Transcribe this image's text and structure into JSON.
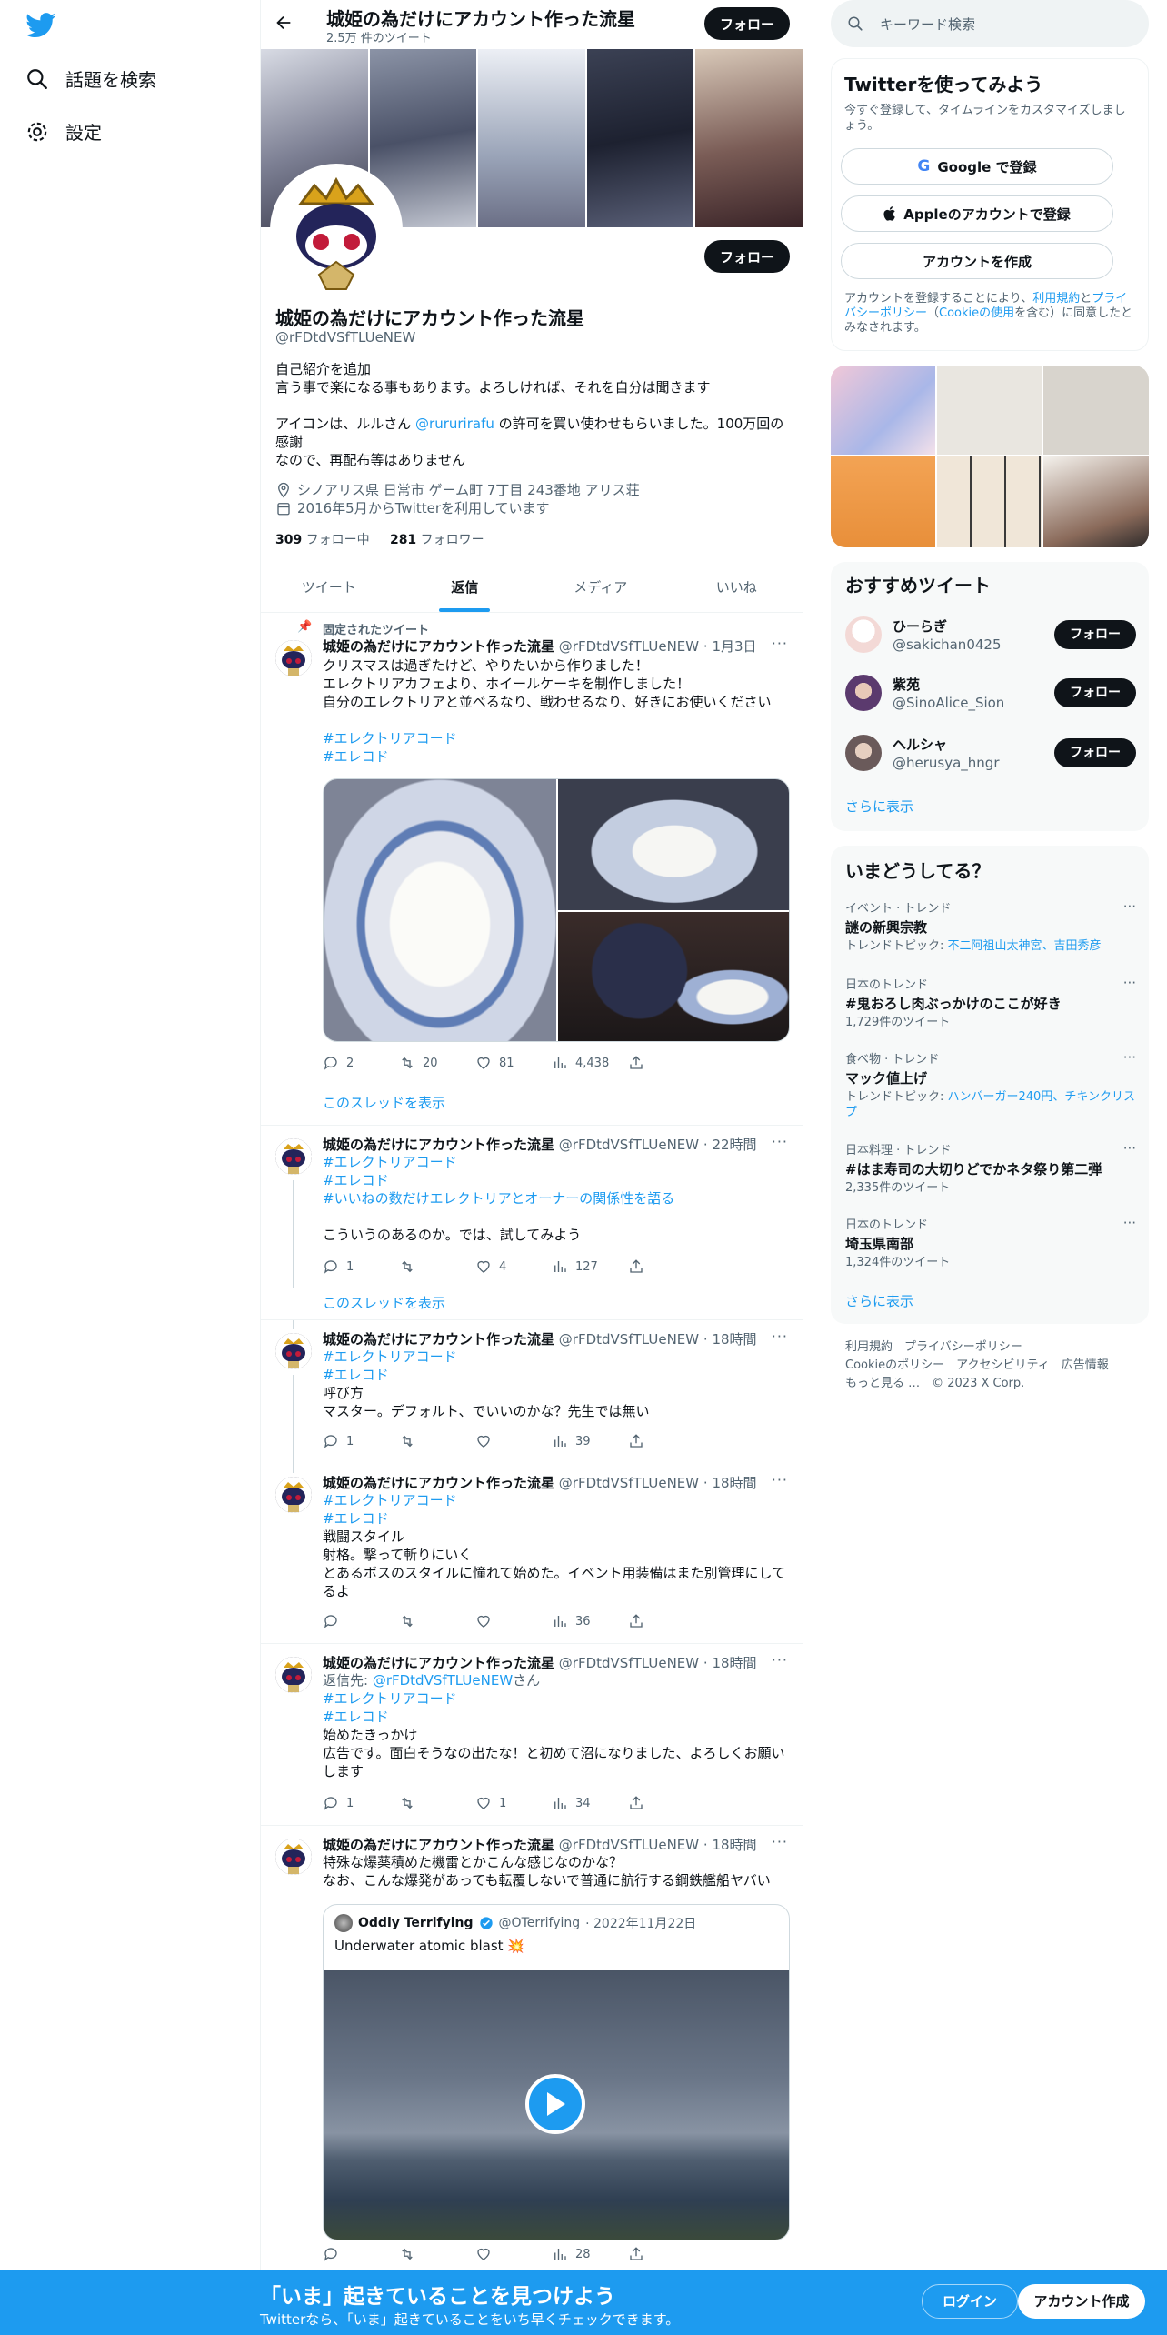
{
  "nav": {
    "explore": "話題を検索",
    "settings": "設定"
  },
  "header": {
    "title": "城姫の為だけにアカウント作った流星",
    "tweet_count": "2.5万 件のツイート",
    "follow": "フォロー"
  },
  "profile": {
    "name": "城姫の為だけにアカウント作った流星",
    "handle": "@rFDtdVSfTLUeNEW",
    "follow": "フォロー",
    "bio_line1": "自己紹介を追加",
    "bio_line2": "言う事で楽になる事もあります。よろしければ、それを自分は聞きます",
    "bio_line3a": "アイコンは、ルルさん ",
    "bio_mention": "@rururirafu",
    "bio_line3b": " の許可を買い使わせもらいました。100万回の感謝",
    "bio_line4": "なので、再配布等はありません",
    "location": "シノアリス県 日常市 ゲーム町 7丁目 243番地 アリス荘",
    "joined": "2016年5月からTwitterを利用しています",
    "following_count": "309",
    "following_label": "フォロー中",
    "followers_count": "281",
    "followers_label": "フォロワー"
  },
  "tabs": [
    "ツイート",
    "返信",
    "メディア",
    "いいね"
  ],
  "tweets": [
    {
      "pinned": "固定されたツイート",
      "name": "城姫の為だけにアカウント作った流星",
      "handle": "@rFDtdVSfTLUeNEW",
      "time": "· 1月3日",
      "text1": "クリスマスは過ぎたけど、やりたいから作りました！",
      "text2": "エレクトリアカフェより、ホイールケーキを制作しました！",
      "text3": "自分のエレクトリアと並べるなり、戦わせるなり、好きにお使いください",
      "tag1": "#エレクトリアコード",
      "tag2": "#エレコド",
      "replies": "2",
      "retweets": "20",
      "likes": "81",
      "views": "4,438",
      "thread": "このスレッドを表示"
    },
    {
      "name": "城姫の為だけにアカウント作った流星",
      "handle": "@rFDtdVSfTLUeNEW",
      "time": "· 22時間",
      "tag1": "#エレクトリアコード",
      "tag2": "#エレコド",
      "tag3": "#いいねの数だけエレクトリアとオーナーの関係性を語る",
      "text1": "こういうのあるのか。では、試してみよう",
      "replies": "1",
      "retweets": "",
      "likes": "4",
      "views": "127",
      "thread": "このスレッドを表示"
    },
    {
      "name": "城姫の為だけにアカウント作った流星",
      "handle": "@rFDtdVSfTLUeNEW",
      "time": "· 18時間",
      "tag1": "#エレクトリアコード",
      "tag2": "#エレコド",
      "text1": "呼び方",
      "text2": "マスター。デフォルト、でいいのかな？先生では無い",
      "replies": "1",
      "retweets": "",
      "likes": "",
      "views": "39"
    },
    {
      "name": "城姫の為だけにアカウント作った流星",
      "handle": "@rFDtdVSfTLUeNEW",
      "time": "· 18時間",
      "tag1": "#エレクトリアコード",
      "tag2": "#エレコド",
      "text1": "戦闘スタイル",
      "text2": "射格。撃って斬りにいく",
      "text3": "とあるボスのスタイルに憧れて始めた。イベント用装備はまた別管理にしてるよ",
      "replies": "",
      "retweets": "",
      "likes": "",
      "views": "36"
    },
    {
      "name": "城姫の為だけにアカウント作った流星",
      "handle": "@rFDtdVSfTLUeNEW",
      "time": "· 18時間",
      "reply_to_label": "返信先: ",
      "reply_to": "@rFDtdVSfTLUeNEW",
      "reply_to_suffix": "さん",
      "tag1": "#エレクトリアコード",
      "tag2": "#エレコド",
      "text1": "始めたきっかけ",
      "text2": "広告です。面白そうなの出たな！と初めて沼になりました、よろしくお願いします",
      "replies": "1",
      "retweets": "",
      "likes": "1",
      "views": "34"
    },
    {
      "name": "城姫の為だけにアカウント作った流星",
      "handle": "@rFDtdVSfTLUeNEW",
      "time": "· 18時間",
      "text1": "特殊な爆薬積めた機雷とかこんな感じなのかな？",
      "text2": "なお、こんな爆発があっても転覆しないで普通に航行する鋼鉄艦船ヤバい",
      "quote_name": "Oddly Terrifying",
      "quote_handle": "@OTerrifying",
      "quote_time": "· 2022年11月22日",
      "quote_text": "Underwater atomic blast",
      "replies": "",
      "retweets": "",
      "likes": "",
      "views": "28"
    }
  ],
  "right": {
    "search_placeholder": "キーワード検索",
    "signup_title": "Twitterを使ってみよう",
    "signup_sub": "今すぐ登録して、タイムラインをカスタマイズしましょう。",
    "google": "Google で登録",
    "apple": "Appleのアカウントで登録",
    "create": "アカウントを作成",
    "legal_a": "アカウントを登録することにより、",
    "legal_terms": "利用規約",
    "legal_b": "と",
    "legal_privacy": "プライバシーポリシー",
    "legal_c": "（",
    "legal_cookie": "Cookieの使用",
    "legal_d": "を含む）に同意したとみなされます。",
    "rec_title": "おすすめツイート",
    "recs": [
      {
        "name": "ひーらぎ",
        "handle": "@sakichan0425",
        "follow": "フォロー"
      },
      {
        "name": "紫苑",
        "handle": "@SinoAlice_Sion",
        "follow": "フォロー"
      },
      {
        "name": "ヘルシャ",
        "handle": "@herusya_hngr",
        "follow": "フォロー"
      }
    ],
    "show_more": "さらに表示",
    "trends_title": "いまどうしてる？",
    "trends": [
      {
        "cat": "イベント · トレンド",
        "title": "謎の新興宗教",
        "sub_label": "トレンドトピック: ",
        "sub_link": "不二阿祖山太神宮、吉田秀彦"
      },
      {
        "cat": "日本のトレンド",
        "title": "#鬼おろし肉ぶっかけのここが好き",
        "sub_label": "1,729件のツイート",
        "sub_link": ""
      },
      {
        "cat": "食べ物 · トレンド",
        "title": "マック値上げ",
        "sub_label": "トレンドトピック: ",
        "sub_link": "ハンバーガー240円、チキンクリスプ"
      },
      {
        "cat": "日本料理 · トレンド",
        "title": "#はま寿司の大切りどでかネタ祭り第二弾",
        "sub_label": "2,335件のツイート",
        "sub_link": ""
      },
      {
        "cat": "日本のトレンド",
        "title": "埼玉県南部",
        "sub_label": "1,324件のツイート",
        "sub_link": ""
      }
    ],
    "trends_more": "さらに表示",
    "footer1": "利用規約　プライバシーポリシー",
    "footer2": "Cookieのポリシー　アクセシビリティ　広告情報",
    "footer3": "もっと見る …　© 2023 X Corp."
  },
  "bottom": {
    "title": "「いま」起きていることを見つけよう",
    "sub": "Twitterなら、「いま」起きていることをいち早くチェックできます。",
    "login": "ログイン",
    "signup": "アカウント作成"
  },
  "colors": {
    "accent": "#1d9bf0",
    "text": "#0f1419",
    "muted": "#536471"
  }
}
